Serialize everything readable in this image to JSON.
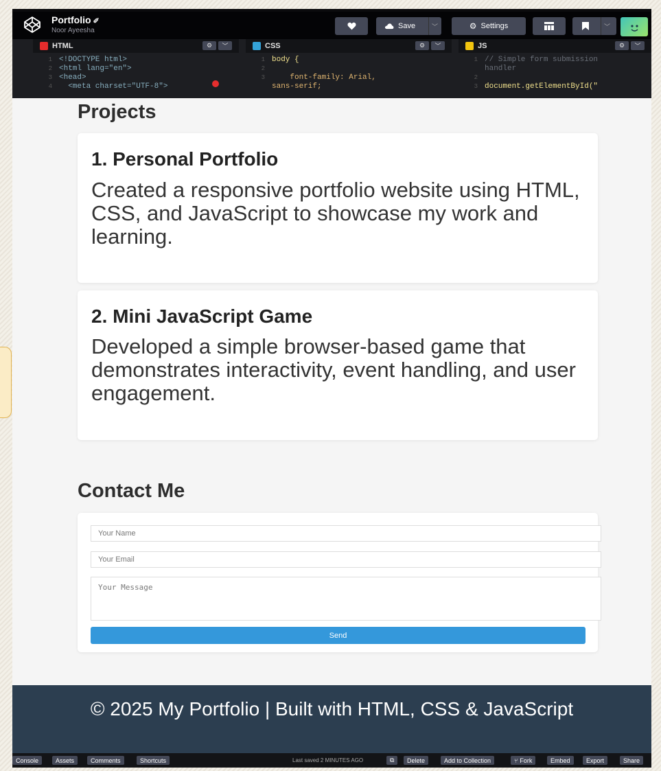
{
  "topbar": {
    "project_title": "Portfolio",
    "author": "Noor Ayeesha",
    "save_label": "Save",
    "settings_label": "Settings",
    "heart_icon": "heart-icon",
    "accent": "#444857"
  },
  "editors": {
    "html": {
      "title": "HTML",
      "color": "#e42c2c",
      "lines": [
        "<!DOCTYPE html>",
        "<html lang=\"en\">",
        "<head>",
        "  <meta charset=\"UTF-8\">"
      ]
    },
    "css": {
      "title": "CSS",
      "color": "#34a3d9",
      "lines": [
        "body {",
        "",
        "    font-family: Arial,",
        "sans-serif;"
      ]
    },
    "js": {
      "title": "JS",
      "color": "#f1c40f",
      "lines": [
        "// Simple form submission",
        "handler",
        "",
        "document.getElementById(\""
      ]
    }
  },
  "preview": {
    "projects_heading": "Projects",
    "projects": [
      {
        "title": "1. Personal Portfolio",
        "text": "Created a responsive portfolio website using HTML, CSS, and JavaScript to showcase my work and learning."
      },
      {
        "title": "2. Mini JavaScript Game",
        "text": "Developed a simple browser-based game that demonstrates interactivity, event handling, and user engagement."
      }
    ],
    "contact_heading": "Contact Me",
    "form": {
      "name_placeholder": "Your Name",
      "email_placeholder": "Your Email",
      "message_placeholder": "Your Message",
      "send_label": "Send",
      "send_color": "#3498db"
    },
    "footer_text": "© 2025 My Portfolio | Built with HTML, CSS & JavaScript",
    "footer_color": "#2c3e50"
  },
  "bottombar": {
    "console": "Console",
    "assets": "Assets",
    "comments": "Comments",
    "shortcuts": "Shortcuts",
    "status": "Last saved 2 MINUTES AGO",
    "delete": "Delete",
    "add_to_collection": "Add to Collection",
    "fork": "Fork",
    "embed": "Embed",
    "export": "Export",
    "share": "Share"
  }
}
